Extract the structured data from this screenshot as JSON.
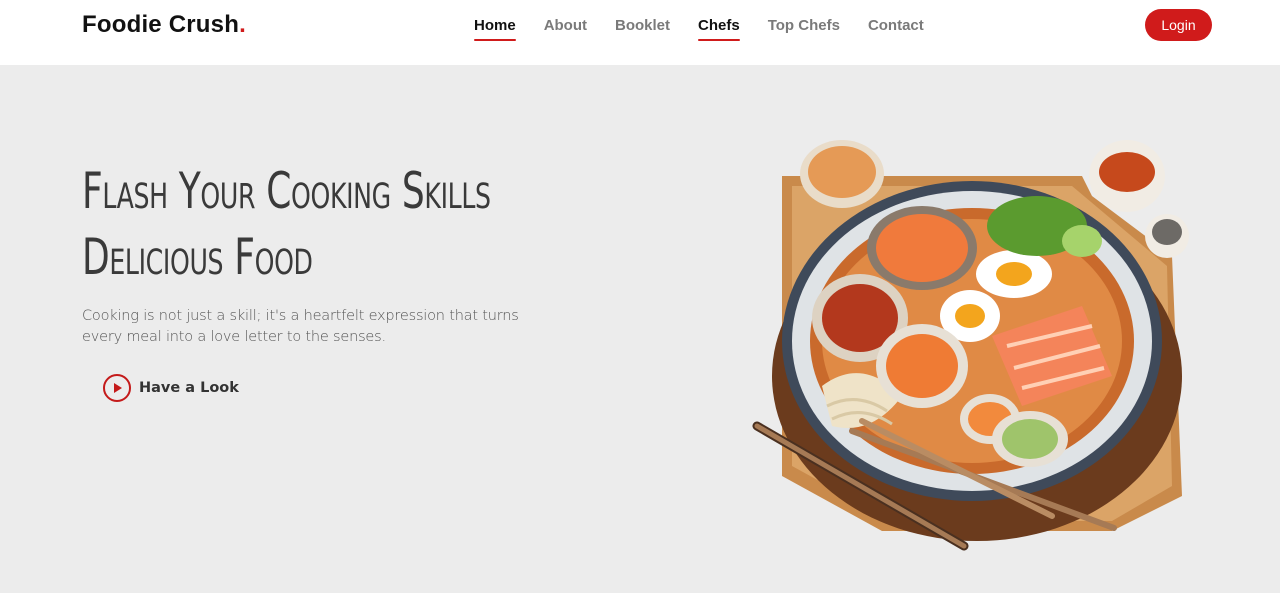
{
  "header": {
    "logo_text": "Foodie Crush",
    "logo_dot": ".",
    "nav": [
      {
        "label": "Home",
        "active": true
      },
      {
        "label": "About",
        "active": false
      },
      {
        "label": "Booklet",
        "active": false
      },
      {
        "label": "Chefs",
        "active": true
      },
      {
        "label": "Top Chefs",
        "active": false
      },
      {
        "label": "Contact",
        "active": false
      }
    ],
    "login_label": "Login"
  },
  "hero": {
    "title_line1": "Flash Your Cooking Skills",
    "title_line2": "Delicious Food",
    "description": "Cooking is not just a skill; it's a heartfelt expression that turns every meal into a love letter to the senses.",
    "cta_label": "Have a Look",
    "cta_icon": "play-circle-icon",
    "image": "food-bowl-illustration"
  },
  "colors": {
    "accent": "#d01b1b",
    "hero_background": "#ececec",
    "heading": "#3a3a3a"
  }
}
